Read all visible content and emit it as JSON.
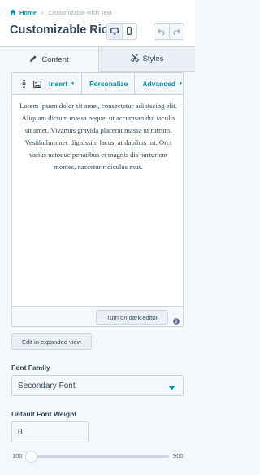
{
  "header": {
    "breadcrumb": {
      "home": "Home",
      "current": "Customizable Rich Text",
      "separator": "›"
    },
    "title": "Customizable Ric...",
    "device_toggle": [
      "desktop-icon",
      "mobile-icon"
    ],
    "history": [
      "undo-icon",
      "redo-icon"
    ]
  },
  "tabs": [
    {
      "label": "Content",
      "icon": "pencil-icon",
      "active": true
    },
    {
      "label": "Styles",
      "icon": "scissors-icon",
      "active": false
    }
  ],
  "editor": {
    "toolbar": {
      "icons": [
        "variable-icon",
        "image-icon"
      ],
      "insert": "Insert",
      "personalize": "Personalize",
      "advanced": "Advanced"
    },
    "body_text": "Lorem ipsum dolor sit amet, consectetur adipiscing elit. Aliquam dictum massa neque, ut accumsan dui iaculis sit amet. Vivamus gravida placerat massa ut rutrum. Vestibulum nec dignissim lacus, at dapibus mi. Orci varius natoque penatibus et magnis dis parturient montes, nascetur ridiculus mus.",
    "dark_editor_button": "Turn on dark editor",
    "expanded_view_button": "Edit in expanded view"
  },
  "fields": {
    "font_family": {
      "label": "Font Family",
      "value": "Secondary Font"
    },
    "font_weight": {
      "label": "Default Font Weight",
      "value": "0"
    }
  },
  "slider": {
    "min": "100",
    "max": "900",
    "level_fraction": 0
  },
  "colors": {
    "accent": "#0091ae",
    "text": "#33475b",
    "border": "#cbd6e2",
    "panel": "#f5f8fa"
  }
}
